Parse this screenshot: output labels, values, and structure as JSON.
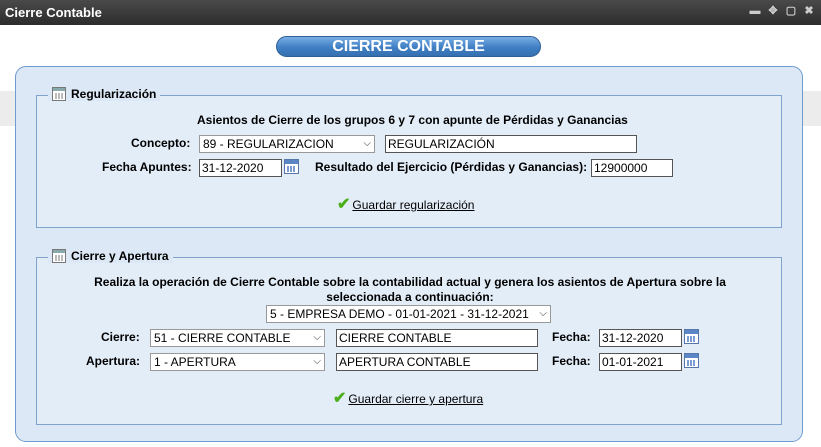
{
  "window": {
    "title": "Cierre Contable"
  },
  "header": {
    "title": "CIERRE CONTABLE"
  },
  "regularizacion": {
    "legend": "Regularización",
    "description": "Asientos de Cierre de los grupos 6 y 7 con apunte de Pérdidas y Ganancias",
    "concepto_label": "Concepto:",
    "concepto_select": "89 - REGULARIZACION",
    "concepto_text": "REGULARIZACIÓN",
    "fecha_label": "Fecha Apuntes:",
    "fecha_value": "31-12-2020",
    "resultado_label": "Resultado del Ejercicio (Pérdidas y Ganancias):",
    "resultado_value": "12900000",
    "save_label": "Guardar regularización"
  },
  "cierre_apertura": {
    "legend": "Cierre y Apertura",
    "description_line1": "Realiza la operación de Cierre Contable sobre la contabilidad actual y genera los asientos de Apertura sobre la",
    "description_line2": "seleccionada a continuación:",
    "empresa_select": "5 - EMPRESA DEMO - 01-01-2021 - 31-12-2021",
    "cierre_label": "Cierre:",
    "cierre_select": "51 - CIERRE CONTABLE",
    "cierre_text": "CIERRE CONTABLE",
    "cierre_fecha_label": "Fecha:",
    "cierre_fecha": "31-12-2020",
    "apertura_label": "Apertura:",
    "apertura_select": "1 - APERTURA",
    "apertura_text": "APERTURA CONTABLE",
    "apertura_fecha_label": "Fecha:",
    "apertura_fecha": "01-01-2021",
    "save_label": "Guardar cierre y apertura"
  },
  "icons": {
    "minimize": "minimize-icon",
    "move": "move-icon",
    "maximize": "maximize-icon",
    "close": "close-icon",
    "calendar": "calendar-icon",
    "checkmark": "checkmark-icon"
  }
}
